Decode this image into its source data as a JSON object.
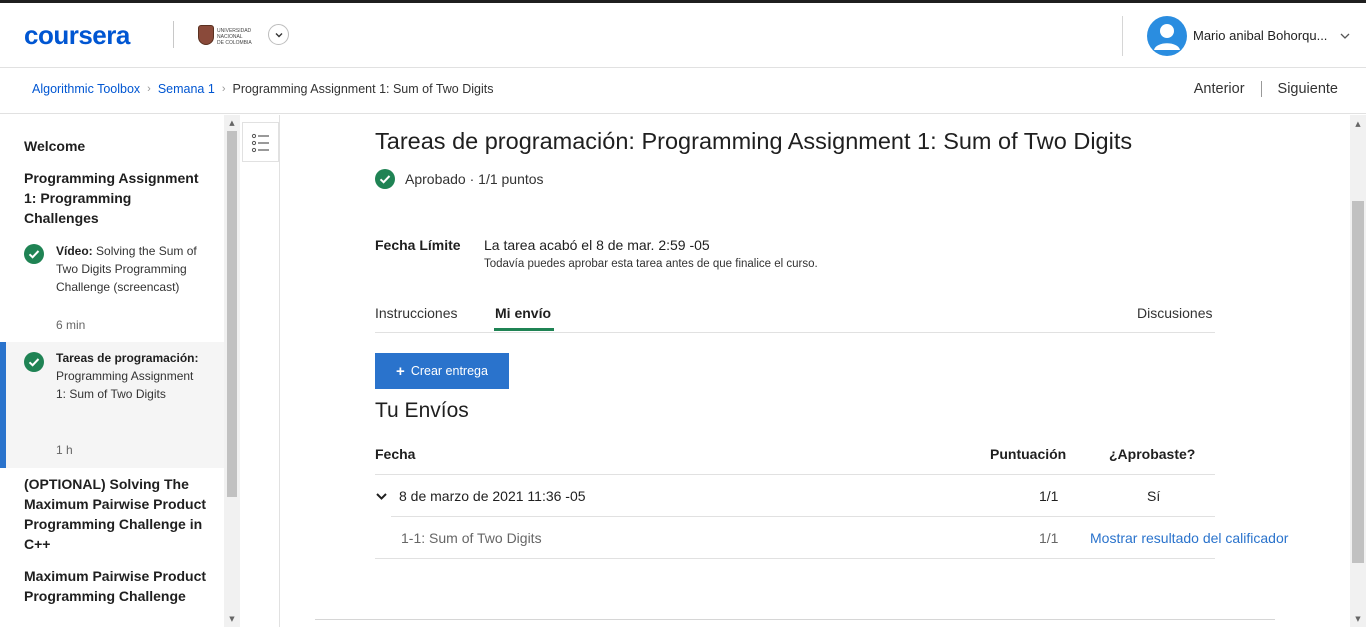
{
  "header": {
    "logo": "coursera",
    "university_lines": [
      "UNIVERSIDAD",
      "NACIONAL",
      "DE COLOMBIA"
    ],
    "user_name": "Mario anibal Bohorqu...",
    "brand_color": "#0056d2"
  },
  "breadcrumb": {
    "items": [
      "Algorithmic Toolbox",
      "Semana 1"
    ],
    "current": "Programming Assignment 1: Sum of Two Digits",
    "prev_label": "Anterior",
    "next_label": "Siguiente"
  },
  "sidebar": {
    "welcome": "Welcome",
    "section_title": "Programming Assignment 1: Programming Challenges",
    "items": [
      {
        "type_label": "Vídeo:",
        "title": "Solving the Sum of Two Digits Programming Challenge (screencast)",
        "duration": "6 min",
        "completed": true,
        "active": false
      },
      {
        "type_label": "Tareas de programación:",
        "title": "Programming Assignment 1: Sum of Two Digits",
        "duration": "1 h",
        "completed": true,
        "active": true
      }
    ],
    "next_sections": [
      "(OPTIONAL) Solving The Maximum Pairwise Product Programming Challenge in C++",
      "Maximum Pairwise Product Programming Challenge"
    ]
  },
  "main": {
    "title": "Tareas de programación: Programming Assignment 1: Sum of Two Digits",
    "status": "Aprobado · 1/1 puntos",
    "deadline_label": "Fecha Límite",
    "deadline_value": "La tarea acabó el 8 de mar. 2:59 -05",
    "deadline_note": "Todavía puedes aprobar esta tarea antes de que finalice el curso.",
    "tabs": {
      "instructions": "Instrucciones",
      "submission": "Mi envío",
      "discussions": "Discusiones"
    },
    "create_button": "Crear entrega",
    "submissions_title": "Tu Envíos",
    "table": {
      "headers": {
        "date": "Fecha",
        "score": "Puntuación",
        "passed": "¿Aprobaste?"
      },
      "row": {
        "date": "8 de marzo de 2021 11:36 -05",
        "score": "1/1",
        "passed": "Sí"
      },
      "part": {
        "name": "1-1: Sum of Two Digits",
        "score": "1/1",
        "link": "Mostrar resultado del calificador"
      }
    }
  }
}
